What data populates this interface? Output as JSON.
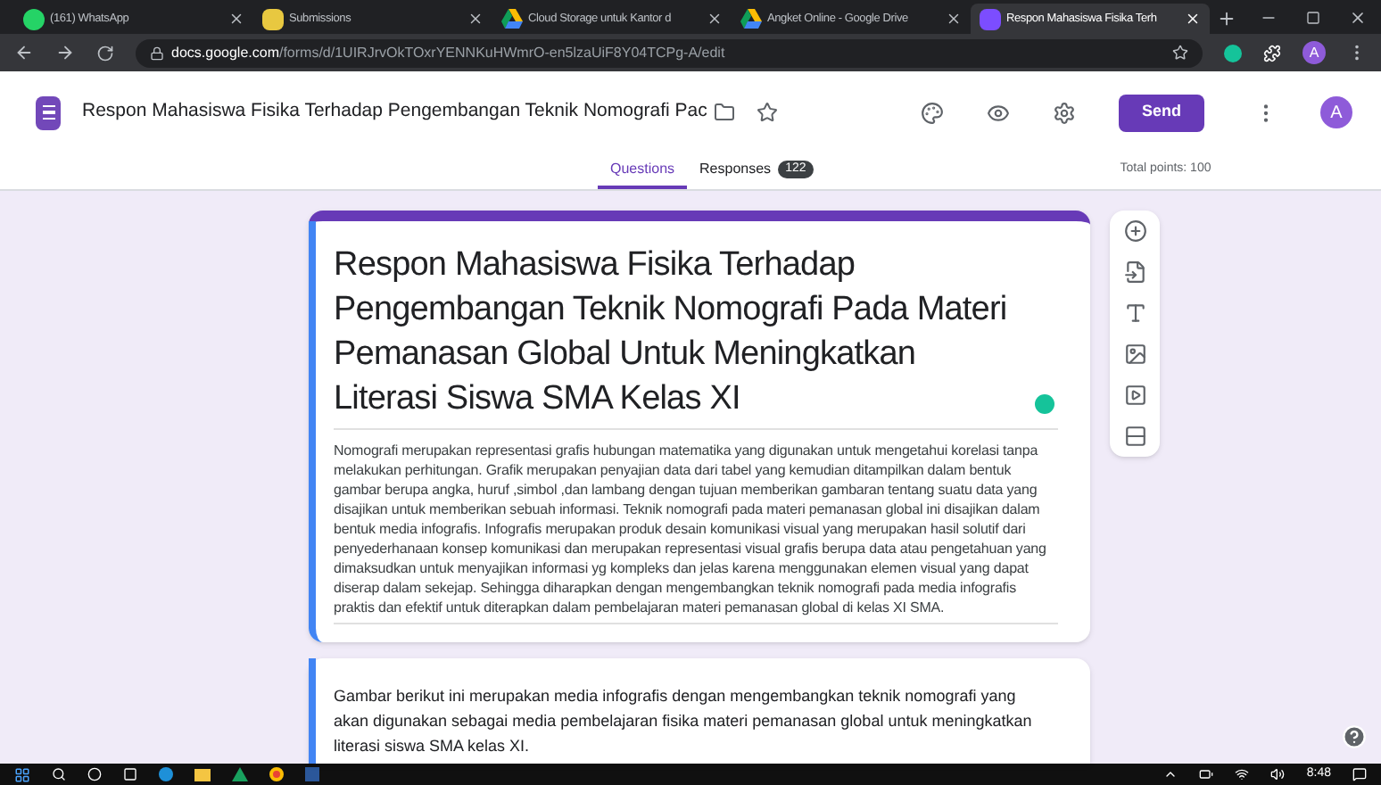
{
  "browser": {
    "tabs": [
      {
        "title": "(161) WhatsApp",
        "kind": "whatsapp",
        "selected": false
      },
      {
        "title": "Submissions",
        "kind": "submissions",
        "selected": false
      },
      {
        "title": "Cloud Storage untuk Kantor d",
        "kind": "drive",
        "selected": false
      },
      {
        "title": "Angket Online - Google Drive",
        "kind": "drive",
        "selected": false
      },
      {
        "title": "Respon Mahasiswa Fisika Terh",
        "kind": "forms",
        "selected": true
      }
    ],
    "address": {
      "domain": "docs.google.com",
      "path": "/forms/d/1UIRJrvOkTOxrYENNKuHWmrO-en5lzaUiF8Y04TCPg-A/edit"
    },
    "profile": "A"
  },
  "header": {
    "title": "Respon Mahasiswa Fisika Terhadap Pengembangan Teknik Nomografi Pac",
    "send": "Send",
    "avatar": "A"
  },
  "nav": {
    "tabs": [
      {
        "label": "Questions",
        "selected": true
      },
      {
        "label": "Responses",
        "badge": "122",
        "selected": false
      }
    ],
    "total_points": "Total points: 100"
  },
  "form": {
    "title": "Respon Mahasiswa Fisika Terhadap Pengembangan Teknik Nomografi Pada Materi Pemanasan Global Untuk Meningkatkan Literasi Siswa SMA Kelas XI",
    "description": "Nomografi merupakan representasi grafis hubungan matematika yang digunakan untuk mengetahui korelasi tanpa melakukan perhitungan. Grafik merupakan penyajian data dari tabel yang kemudian ditampilkan dalam bentuk gambar berupa angka, huruf ,simbol ,dan lambang dengan tujuan memberikan gambaran tentang suatu data yang disajikan untuk memberikan sebuah informasi. Teknik nomografi pada materi pemanasan global ini disajikan dalam bentuk media infografis. Infografis merupakan produk desain komunikasi visual yang merupakan hasil solutif dari penyederhanaan konsep komunikasi dan merupakan representasi visual grafis berupa data atau pengetahuan yang dimaksudkan untuk menyajikan informasi yg kompleks dan jelas karena menggunakan elemen visual yang dapat diserap dalam sekejap. Sehingga diharapkan dengan mengembangkan teknik nomografi pada media infografis praktis dan efektif untuk diterapkan dalam pembelajaran materi pemanasan global di kelas XI SMA.",
    "section_text": "Gambar berikut ini merupakan media infografis dengan mengembangkan teknik nomografi yang akan digunakan sebagai media pembelajaran fisika materi pemanasan global untuk meningkatkan literasi siswa SMA kelas XI."
  },
  "taskbar": {
    "clock": "8:48"
  }
}
